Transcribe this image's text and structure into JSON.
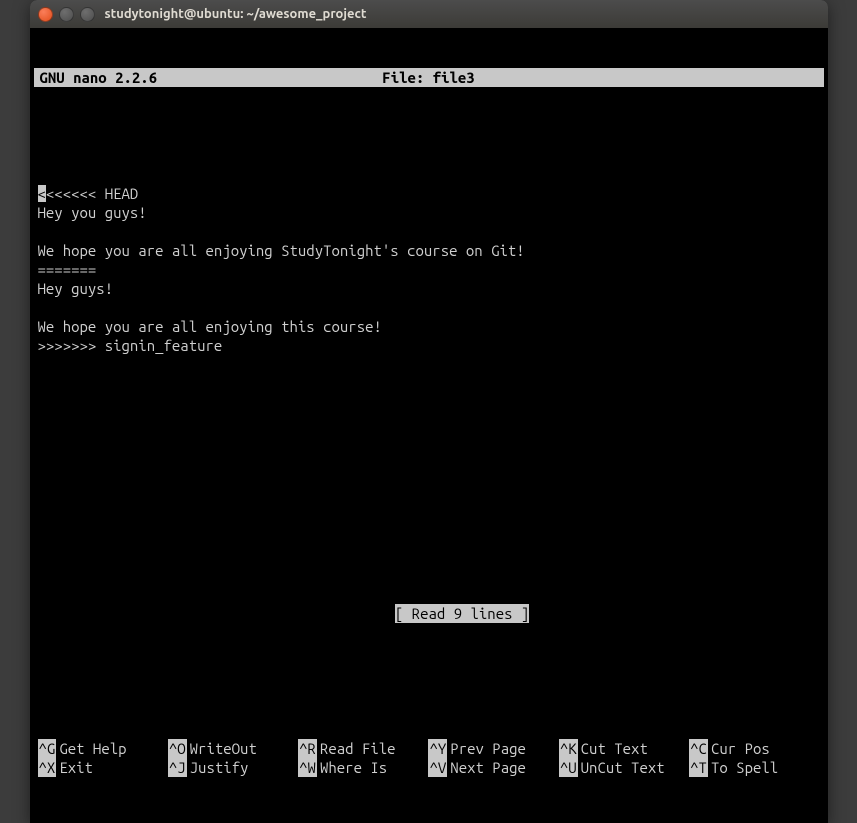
{
  "window": {
    "title": "studytonight@ubuntu: ~/awesome_project"
  },
  "nano": {
    "app_name": "GNU nano 2.2.6",
    "file_label": "File: file3",
    "status": "[ Read 9 lines ]"
  },
  "content": {
    "cursor_char": "<",
    "lines": [
      "<<<<<< HEAD",
      "Hey you guys!",
      "",
      "We hope you are all enjoying StudyTonight's course on Git!",
      "=======",
      "Hey guys!",
      "",
      "We hope you are all enjoying this course!",
      ">>>>>>> signin_feature"
    ]
  },
  "shortcuts": {
    "row1": [
      {
        "key": "^G",
        "desc": "Get Help"
      },
      {
        "key": "^O",
        "desc": "WriteOut"
      },
      {
        "key": "^R",
        "desc": "Read File"
      },
      {
        "key": "^Y",
        "desc": "Prev Page"
      },
      {
        "key": "^K",
        "desc": "Cut Text"
      },
      {
        "key": "^C",
        "desc": "Cur Pos"
      }
    ],
    "row2": [
      {
        "key": "^X",
        "desc": "Exit"
      },
      {
        "key": "^J",
        "desc": "Justify"
      },
      {
        "key": "^W",
        "desc": "Where Is"
      },
      {
        "key": "^V",
        "desc": "Next Page"
      },
      {
        "key": "^U",
        "desc": "UnCut Text"
      },
      {
        "key": "^T",
        "desc": "To Spell"
      }
    ]
  }
}
